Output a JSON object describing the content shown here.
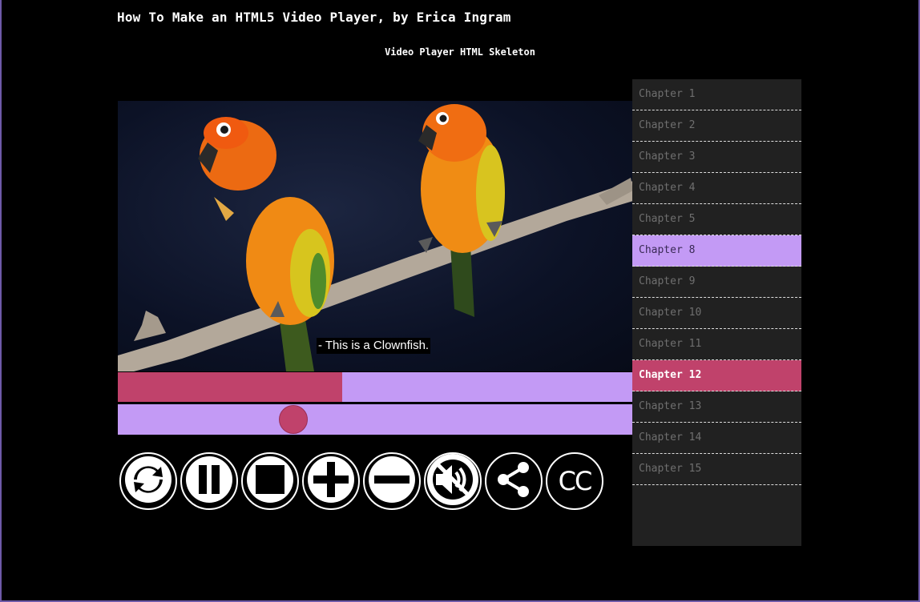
{
  "page": {
    "title": "How To Make an HTML5 Video Player, by Erica Ingram",
    "subtitle": "Video Player HTML Skeleton"
  },
  "player": {
    "caption": "- This is a Clownfish.",
    "progress": 0.435,
    "volume": 0.34,
    "colors": {
      "accent": "#c0426b",
      "track": "#c39af5",
      "panel": "#212121",
      "background": "#000000"
    }
  },
  "controls": [
    {
      "name": "refresh-icon",
      "label": ""
    },
    {
      "name": "pause-icon",
      "label": ""
    },
    {
      "name": "stop-icon",
      "label": ""
    },
    {
      "name": "volume-up-icon",
      "label": ""
    },
    {
      "name": "volume-down-icon",
      "label": ""
    },
    {
      "name": "mute-icon",
      "label": ""
    },
    {
      "name": "share-icon",
      "label": ""
    },
    {
      "name": "cc-icon",
      "label": "CC"
    }
  ],
  "chapters": [
    {
      "label": "Chapter 1",
      "state": ""
    },
    {
      "label": "Chapter 2",
      "state": ""
    },
    {
      "label": "Chapter 3",
      "state": ""
    },
    {
      "label": "Chapter 4",
      "state": ""
    },
    {
      "label": "Chapter 5",
      "state": ""
    },
    {
      "label": "Chapter 8",
      "state": "selected"
    },
    {
      "label": "Chapter 9",
      "state": ""
    },
    {
      "label": "Chapter 10",
      "state": ""
    },
    {
      "label": "Chapter 11",
      "state": ""
    },
    {
      "label": "Chapter 12",
      "state": "active"
    },
    {
      "label": "Chapter 13",
      "state": ""
    },
    {
      "label": "Chapter 14",
      "state": ""
    },
    {
      "label": "Chapter 15",
      "state": ""
    }
  ]
}
